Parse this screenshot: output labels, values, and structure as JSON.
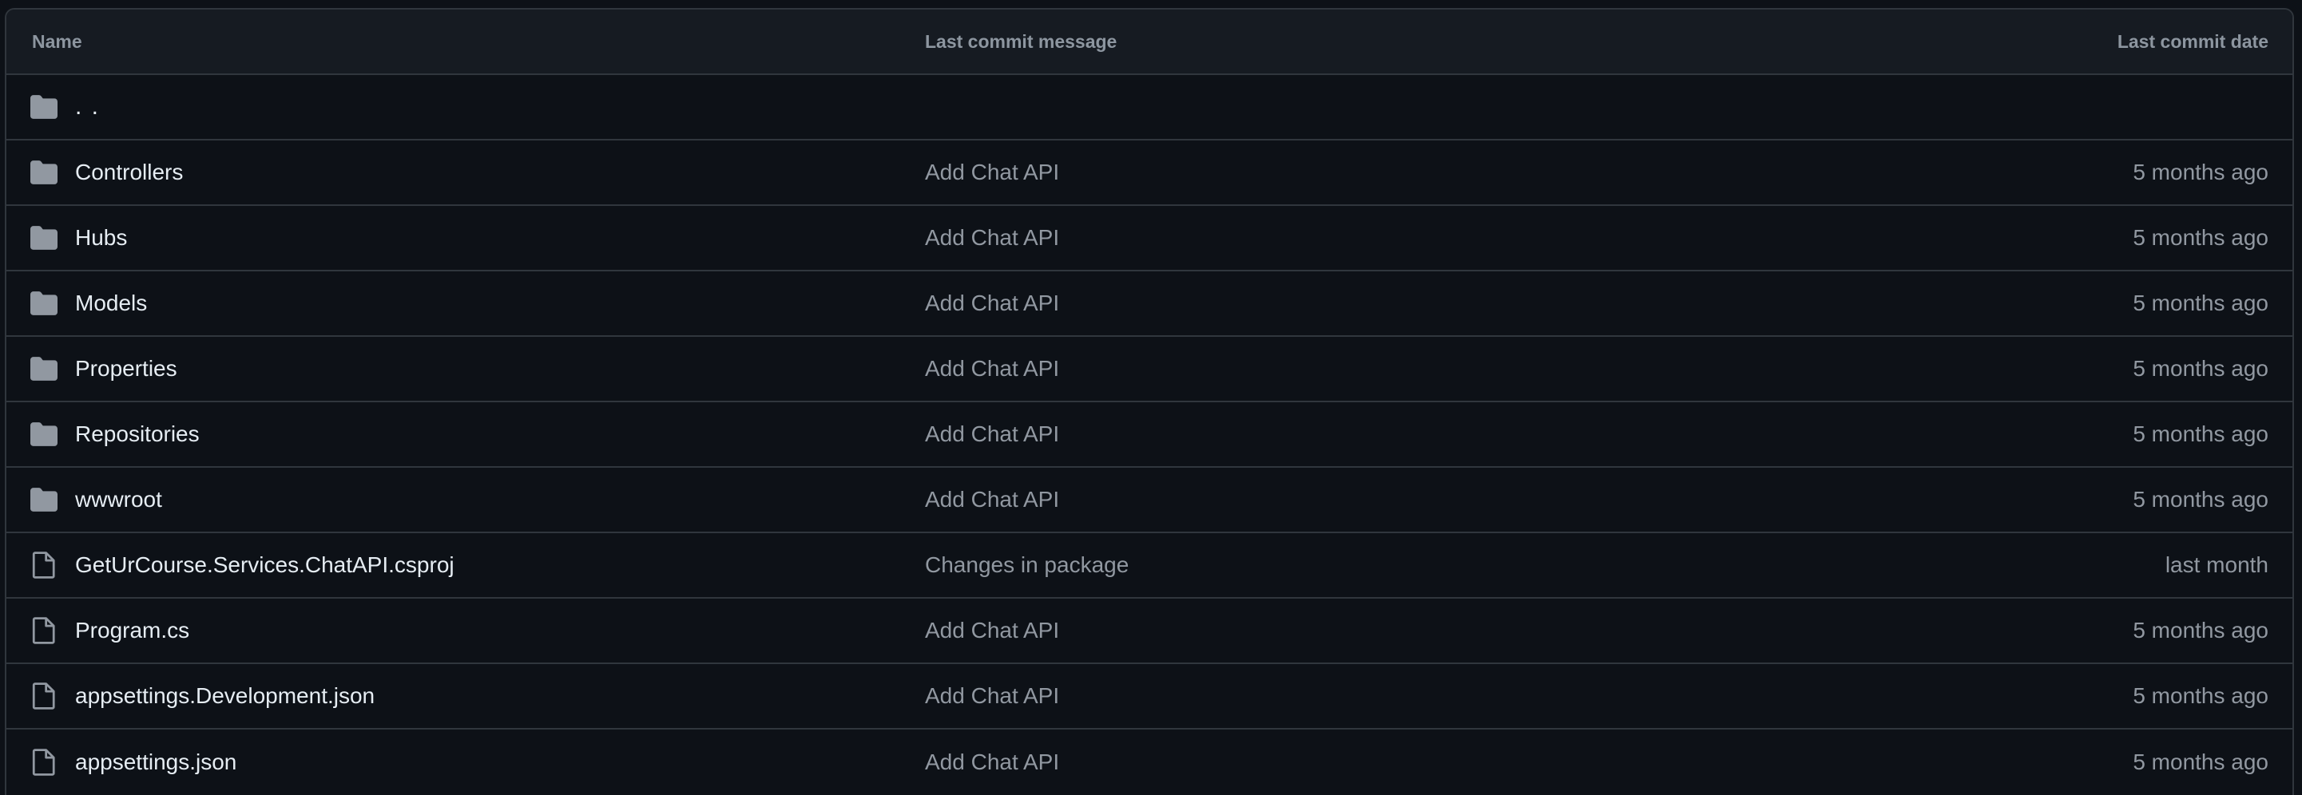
{
  "header": {
    "name": "Name",
    "message": "Last commit message",
    "date": "Last commit date"
  },
  "parent": {
    "label": ". .",
    "icon": "folder-icon"
  },
  "rows": [
    {
      "name": "Controllers",
      "type": "folder",
      "message": "Add Chat API",
      "date": "5 months ago"
    },
    {
      "name": "Hubs",
      "type": "folder",
      "message": "Add Chat API",
      "date": "5 months ago"
    },
    {
      "name": "Models",
      "type": "folder",
      "message": "Add Chat API",
      "date": "5 months ago"
    },
    {
      "name": "Properties",
      "type": "folder",
      "message": "Add Chat API",
      "date": "5 months ago"
    },
    {
      "name": "Repositories",
      "type": "folder",
      "message": "Add Chat API",
      "date": "5 months ago"
    },
    {
      "name": "wwwroot",
      "type": "folder",
      "message": "Add Chat API",
      "date": "5 months ago"
    },
    {
      "name": "GetUrCourse.Services.ChatAPI.csproj",
      "type": "file",
      "message": "Changes in package",
      "date": "last month"
    },
    {
      "name": "Program.cs",
      "type": "file",
      "message": "Add Chat API",
      "date": "5 months ago"
    },
    {
      "name": "appsettings.Development.json",
      "type": "file",
      "message": "Add Chat API",
      "date": "5 months ago"
    },
    {
      "name": "appsettings.json",
      "type": "file",
      "message": "Add Chat API",
      "date": "5 months ago"
    }
  ],
  "colors": {
    "background": "#0d1117",
    "header_background": "#161b22",
    "border": "#30363d",
    "text": "#e6edf3",
    "muted": "#9198a1",
    "icon": "#9198a1"
  }
}
